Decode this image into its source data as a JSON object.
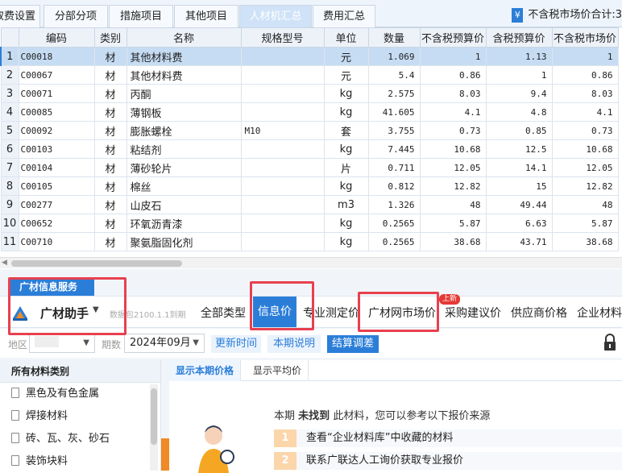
{
  "top_tabs": [
    {
      "label": "取费设置",
      "active": false
    },
    {
      "label": "分部分项",
      "active": false
    },
    {
      "label": "措施项目",
      "active": false
    },
    {
      "label": "其他项目",
      "active": false
    },
    {
      "label": "人材机汇总",
      "active": true
    },
    {
      "label": "费用汇总",
      "active": false
    }
  ],
  "total_label": "不含税市场价合计:3",
  "table": {
    "headers": [
      "",
      "编码",
      "类别",
      "名称",
      "规格型号",
      "单位",
      "数量",
      "不含税预算价",
      "含税预算价",
      "不含税市场价"
    ],
    "rows": [
      {
        "n": "1",
        "code": "C00018",
        "cat": "材",
        "name": "其他材料费",
        "spec": "",
        "unit": "元",
        "qty": "1.069",
        "p1": "1",
        "p2": "1.13",
        "p3": "1"
      },
      {
        "n": "2",
        "code": "C00067",
        "cat": "材",
        "name": "其他材料费",
        "spec": "",
        "unit": "元",
        "qty": "5.4",
        "p1": "0.86",
        "p2": "1",
        "p3": "0.86"
      },
      {
        "n": "3",
        "code": "C00071",
        "cat": "材",
        "name": "丙酮",
        "spec": "",
        "unit": "kg",
        "qty": "2.575",
        "p1": "8.03",
        "p2": "9.4",
        "p3": "8.03"
      },
      {
        "n": "4",
        "code": "C00085",
        "cat": "材",
        "name": "薄钢板",
        "spec": "",
        "unit": "kg",
        "qty": "41.605",
        "p1": "4.1",
        "p2": "4.8",
        "p3": "4.1"
      },
      {
        "n": "5",
        "code": "C00092",
        "cat": "材",
        "name": "膨胀螺栓",
        "spec": "M10",
        "unit": "套",
        "qty": "3.755",
        "p1": "0.73",
        "p2": "0.85",
        "p3": "0.73"
      },
      {
        "n": "6",
        "code": "C00103",
        "cat": "材",
        "name": "粘结剂",
        "spec": "",
        "unit": "kg",
        "qty": "7.445",
        "p1": "10.68",
        "p2": "12.5",
        "p3": "10.68"
      },
      {
        "n": "7",
        "code": "C00104",
        "cat": "材",
        "name": "薄砂轮片",
        "spec": "",
        "unit": "片",
        "qty": "0.711",
        "p1": "12.05",
        "p2": "14.1",
        "p3": "12.05"
      },
      {
        "n": "8",
        "code": "C00105",
        "cat": "材",
        "name": "棉丝",
        "spec": "",
        "unit": "kg",
        "qty": "0.812",
        "p1": "12.82",
        "p2": "15",
        "p3": "12.82"
      },
      {
        "n": "9",
        "code": "C00277",
        "cat": "材",
        "name": "山皮石",
        "spec": "",
        "unit": "m3",
        "qty": "1.326",
        "p1": "48",
        "p2": "49.44",
        "p3": "48"
      },
      {
        "n": "10",
        "code": "C00652",
        "cat": "材",
        "name": "环氧沥青漆",
        "spec": "",
        "unit": "kg",
        "qty": "0.2565",
        "p1": "5.87",
        "p2": "6.63",
        "p3": "5.87"
      },
      {
        "n": "11",
        "code": "C00710",
        "cat": "材",
        "name": "聚氨脂固化剂",
        "spec": "",
        "unit": "kg",
        "qty": "0.2565",
        "p1": "38.68",
        "p2": "43.71",
        "p3": "38.68"
      }
    ]
  },
  "service": {
    "tab_label": "广材信息服务",
    "assistant_label": "广材助手",
    "db_info": "数据包2100.1.1到期",
    "nav_tabs": [
      {
        "label": "全部类型",
        "active": false
      },
      {
        "label": "信息价",
        "active": true
      },
      {
        "label": "专业测定价",
        "active": false
      },
      {
        "label": "广材网市场价",
        "active": false
      },
      {
        "label": "采购建议价",
        "active": false
      },
      {
        "label": "供应商价格",
        "active": false
      },
      {
        "label": "企业材料",
        "active": false
      }
    ],
    "new_badge": "上新",
    "filters": {
      "region_label": "地区",
      "period_label": "期数",
      "period_value": "2024年09月",
      "update_time": "更新时间",
      "period_desc": "本期说明",
      "settle": "结算调差"
    },
    "category_title": "所有材料类别",
    "categories": [
      "黑色及有色金属",
      "焊接材料",
      "砖、瓦、灰、砂石",
      "装饰块料"
    ],
    "sub_tabs": [
      "显示本期价格",
      "显示平均价"
    ],
    "notfound_prefix": "本期",
    "notfound_bold": "未找到",
    "notfound_suffix": "此材料，您可以参考以下报价来源",
    "hints": [
      {
        "n": "1",
        "text": "查看“企业材料库”中收藏的材料"
      },
      {
        "n": "2",
        "text": "联系广联达人工询价获取专业报价"
      }
    ]
  },
  "colors": {
    "accent": "#2b7ed8",
    "highlight_box": "#e8404f",
    "selected_row": "#c6dcf3"
  }
}
